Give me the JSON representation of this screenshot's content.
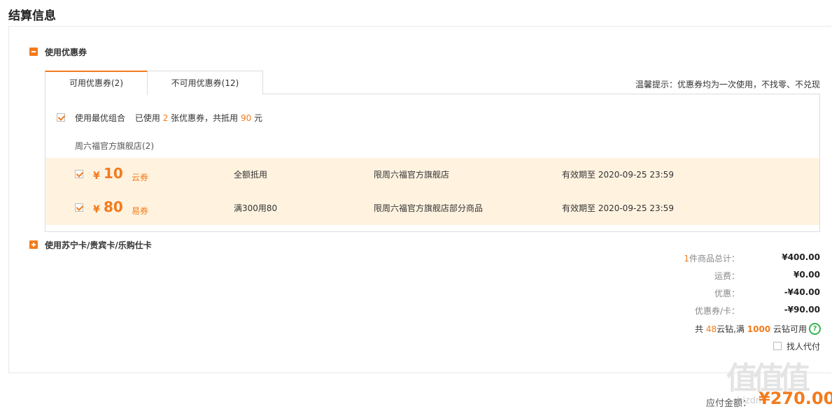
{
  "page": {
    "title": "结算信息"
  },
  "coupon_section": {
    "title": "使用优惠券",
    "tabs": [
      {
        "label": "可用优惠券(2)"
      },
      {
        "label": "不可用优惠券(12)"
      }
    ],
    "tip": "温馨提示：优惠券均为一次使用，不找零、不兑现",
    "best_combo": {
      "label": "使用最优组合",
      "used_prefix": "已使用",
      "used_count": "2",
      "used_mid": "张优惠券，共抵用",
      "deduct_amount": "90",
      "deduct_unit": "元"
    },
    "store_title": "周六福官方旗舰店(2)",
    "coupons": [
      {
        "currency": "¥",
        "amount": "10",
        "type": "云券",
        "rule": "全额抵用",
        "scope": "限周六福官方旗舰店",
        "expiry": "有效期至 2020-09-25 23:59"
      },
      {
        "currency": "¥",
        "amount": "80",
        "type": "易券",
        "rule": "满300用80",
        "scope": "限周六福官方旗舰店部分商品",
        "expiry": "有效期至 2020-09-25 23:59"
      }
    ]
  },
  "card_section": {
    "title": "使用苏宁卡/贵宾卡/乐购仕卡"
  },
  "summary": {
    "items_count": "1",
    "items_label": "件商品总计：",
    "items_total": "¥400.00",
    "shipping_label": "运费：",
    "shipping_value": "¥0.00",
    "discount_label": "优惠：",
    "discount_value": "-¥40.00",
    "coupon_label": "优惠券/卡：",
    "coupon_value": "-¥90.00",
    "yunzuan_prefix": "共",
    "yunzuan_count": "48",
    "yunzuan_mid": "云钻,满",
    "yunzuan_threshold": "1000",
    "yunzuan_suffix": "云钻可用",
    "pay_for_me": "找人代付"
  },
  "payable": {
    "label": "应付金额：",
    "value": "¥270.00"
  },
  "watermark": {
    "text": "值值值",
    "site": "hizdm"
  },
  "colors": {
    "accent": "#f37b1d",
    "coupon_bg": "#fff3e0",
    "help_green": "#37b24d"
  }
}
